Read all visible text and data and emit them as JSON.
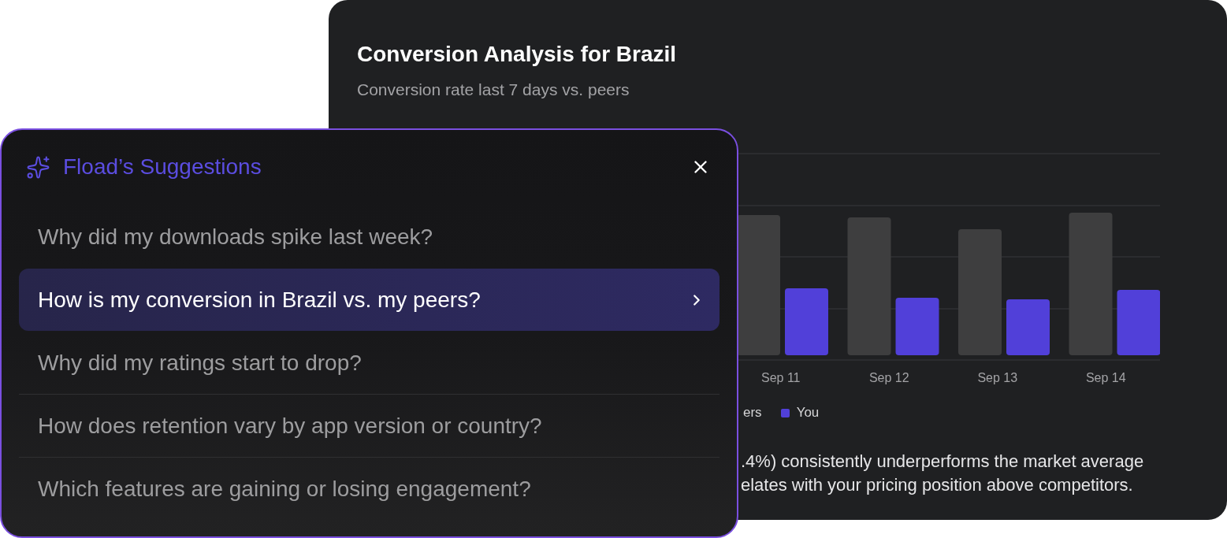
{
  "chart_card": {
    "title": "Conversion Analysis for Brazil",
    "subtitle": "Conversion rate last 7 days vs. peers",
    "chart": {
      "x_labels": [
        "Sep 11",
        "Sep 12",
        "Sep 13",
        "Sep 14"
      ],
      "legend": [
        {
          "label": "ers"
        },
        {
          "label": "You",
          "color": "#5140d9"
        }
      ]
    },
    "summary_lines": [
      ".4%) consistently underperforms the market average",
      "elates with your pricing position above competitors."
    ]
  },
  "suggestions_panel": {
    "title": "Fload’s Suggestions",
    "items": [
      {
        "text": "Why did my downloads spike last week?",
        "selected": false
      },
      {
        "text": "How is my conversion in Brazil vs. my peers?",
        "selected": true
      },
      {
        "text": "Why did my ratings start to drop?",
        "selected": false
      },
      {
        "text": "How does retention vary by app version or country?",
        "selected": false
      },
      {
        "text": "Which features are gaining or losing engagement?",
        "selected": false
      }
    ]
  }
}
